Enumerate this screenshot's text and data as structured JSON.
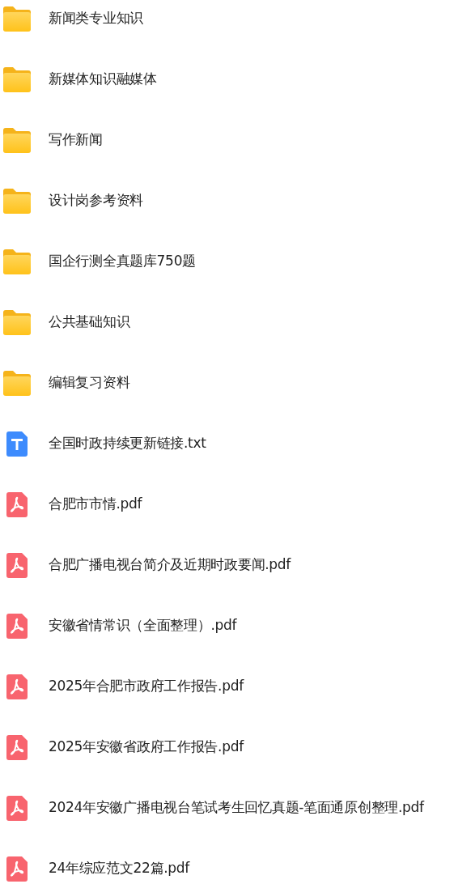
{
  "files": [
    {
      "kind": "folder",
      "name": "新闻类专业知识"
    },
    {
      "kind": "folder",
      "name": "新媒体知识融媒体"
    },
    {
      "kind": "folder",
      "name": "写作新闻"
    },
    {
      "kind": "folder",
      "name": "设计岗参考资料"
    },
    {
      "kind": "folder",
      "name": "国企行测全真题库750题"
    },
    {
      "kind": "folder",
      "name": "公共基础知识"
    },
    {
      "kind": "folder",
      "name": "编辑复习资料"
    },
    {
      "kind": "txt",
      "name": "全国时政持续更新链接.txt"
    },
    {
      "kind": "pdf",
      "name": "合肥市市情.pdf"
    },
    {
      "kind": "pdf",
      "name": "合肥广播电视台简介及近期时政要闻.pdf"
    },
    {
      "kind": "pdf",
      "name": "安徽省情常识（全面整理）.pdf"
    },
    {
      "kind": "pdf",
      "name": "2025年合肥市政府工作报告.pdf"
    },
    {
      "kind": "pdf",
      "name": "2025年安徽省政府工作报告.pdf"
    },
    {
      "kind": "pdf",
      "name": "2024年安徽广播电视台笔试考生回忆真题-笔面通原创整理.pdf"
    },
    {
      "kind": "pdf",
      "name": "24年综应范文22篇.pdf"
    }
  ]
}
